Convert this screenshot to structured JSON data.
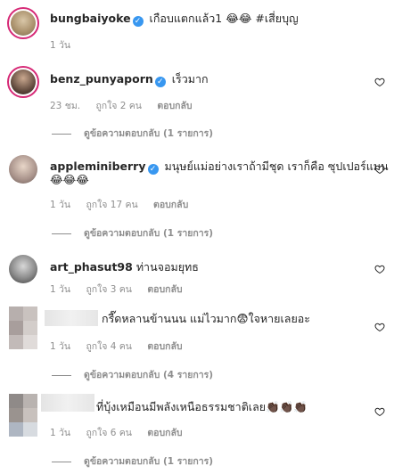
{
  "post": {
    "username": "bungbaiyoke",
    "text": "เกือบแตกแล้ว1 😂😂 #เสี่ยบุญ",
    "time": "1 วัน"
  },
  "comments": [
    {
      "username": "benz_punyaporn",
      "text": "เร็วมาก",
      "time": "23 ชม.",
      "likes": "ถูกใจ 2 คน",
      "reply": "ตอบกลับ"
    },
    {
      "username": "appleminiberry",
      "text": "มนุษย์แม่อย่างเราถ้ามีชุด เราก็คือ ซุปเปอร์แมน",
      "text2": "😂😂😂",
      "time": "1 วัน",
      "likes": "ถูกใจ 17 คน",
      "reply": "ตอบกลับ",
      "view_replies": "ดูข้อความตอบกลับ (1 รายการ)"
    },
    {
      "username": "art_phasut98",
      "text": "ท่านจอมยุทธ",
      "time": "1 วัน",
      "likes": "ถูกใจ 3 คน",
      "reply": "ตอบกลับ"
    },
    {
      "text": "กรี๊ดหลานข้านนน แม่ไวมาก😨ใจหายเลยอะ",
      "time": "1 วัน",
      "likes": "ถูกใจ 4 คน",
      "reply": "ตอบกลับ",
      "view_replies": "ดูข้อความตอบกลับ (4 รายการ)"
    },
    {
      "text": "ที่บุ้งเหมือนมีพลังเหนือธรรมชาติเลย👏🏿👏🏿👏🏿",
      "time": "1 วัน",
      "likes": "ถูกใจ 6 คน",
      "reply": "ตอบกลับ",
      "view_replies": "ดูข้อความตอบกลับ (1 รายการ)"
    }
  ],
  "first_view_replies": "ดูข้อความตอบกลับ (1 รายการ)",
  "colors": {
    "accent": "#3897f0",
    "muted": "#8e8e8e",
    "text": "#262626"
  }
}
